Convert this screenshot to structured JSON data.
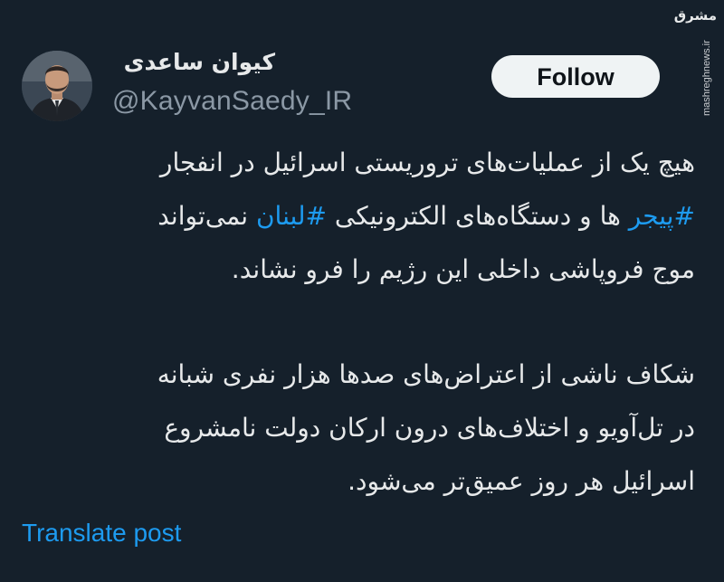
{
  "user": {
    "display_name": "کیوان ساعدی",
    "handle": "@KayvanSaedy_IR"
  },
  "actions": {
    "follow_label": "Follow",
    "translate_label": "Translate post"
  },
  "watermark": {
    "logo_text": "مشرق",
    "url": "mashreghnews.ir"
  },
  "tweet": {
    "line1": "هیچ یک از عملیات‌های تروریستی اسرائیل در انفجار",
    "hashtag1": "#پیجر",
    "line2_mid": " ها و دستگاه‌های الکترونیکی ",
    "hashtag2": "#لبنان",
    "line2_end": " نمی‌تواند",
    "line3": "موج فروپاشی داخلی این رژیم را فرو نشاند.",
    "para2_line1": "شکاف ناشی از اعتراض‌های صدها هزار نفری شبانه",
    "para2_line2": "در تل‌آویو و اختلاف‌های درون ارکان دولت نامشروع",
    "para2_line3": "اسرائیل هر روز عمیق‌تر می‌شود."
  },
  "colors": {
    "background": "#15202b",
    "text": "#e7e9ea",
    "secondary_text": "#8b98a5",
    "link": "#1d9bf0",
    "button_bg": "#eff3f4"
  }
}
